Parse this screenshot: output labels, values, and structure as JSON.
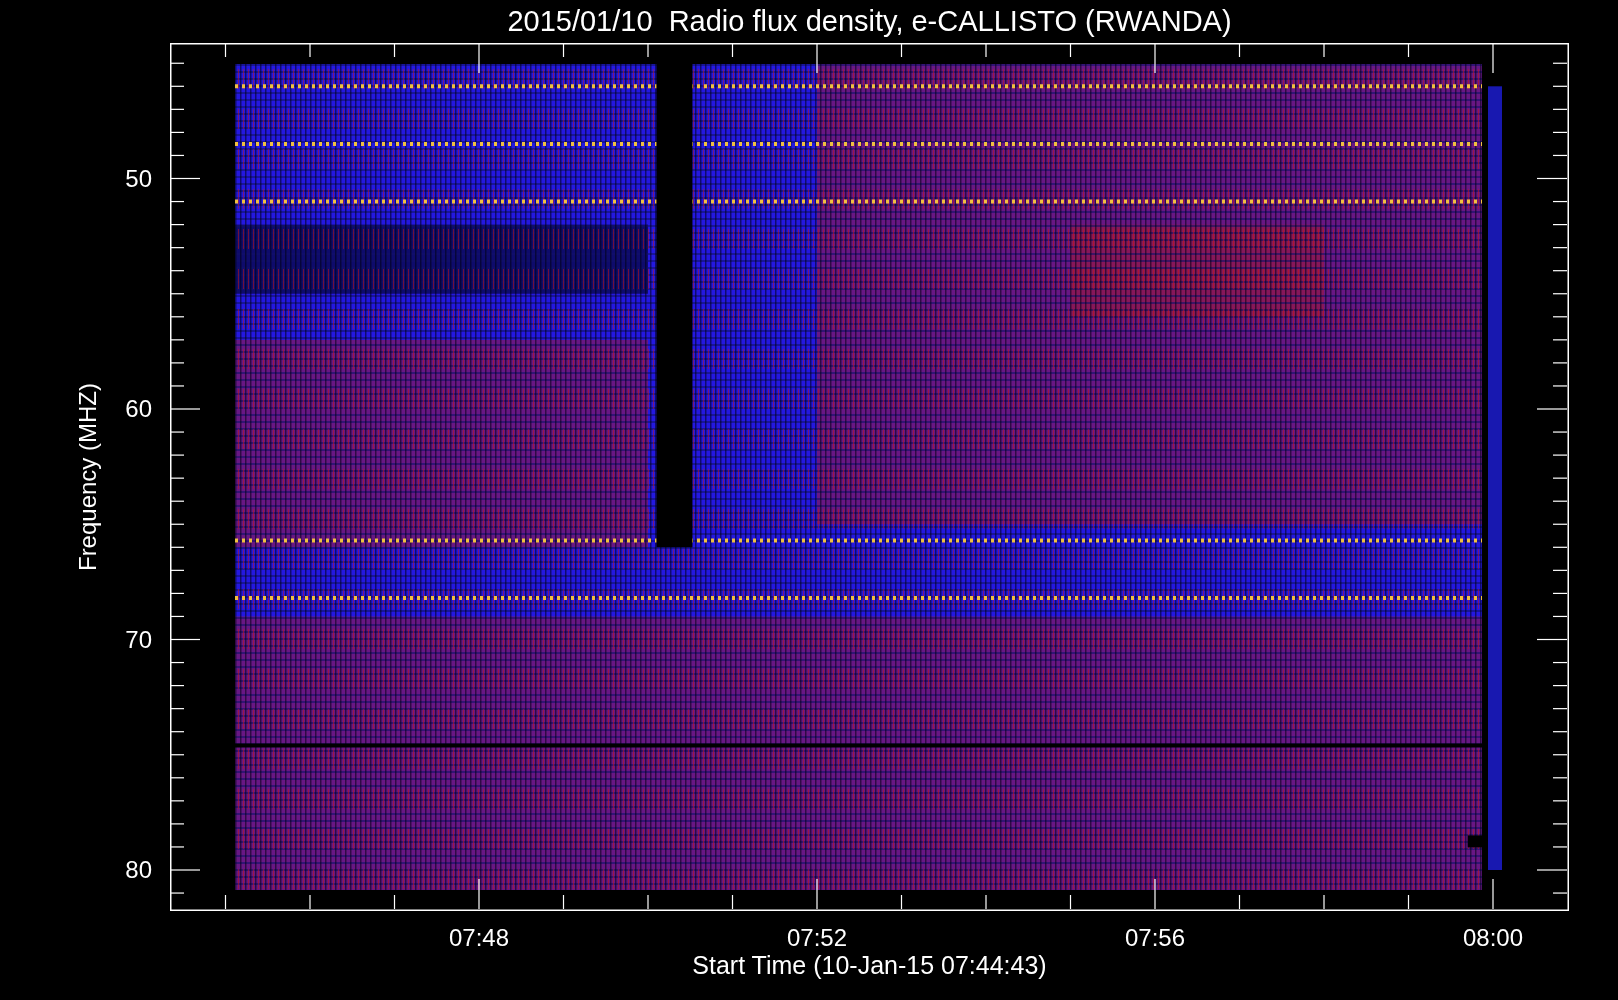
{
  "title": "2015/01/10  Radio flux density, e-CALLISTO (RWANDA)",
  "y_axis": {
    "label": "Frequency (MHZ)",
    "ticks": [
      "50",
      "60",
      "70",
      "80"
    ]
  },
  "x_axis": {
    "label": "Start Time (10-Jan-15 07:44:43)",
    "ticks": [
      "07:48",
      "07:52",
      "07:56",
      "08:00"
    ]
  }
}
